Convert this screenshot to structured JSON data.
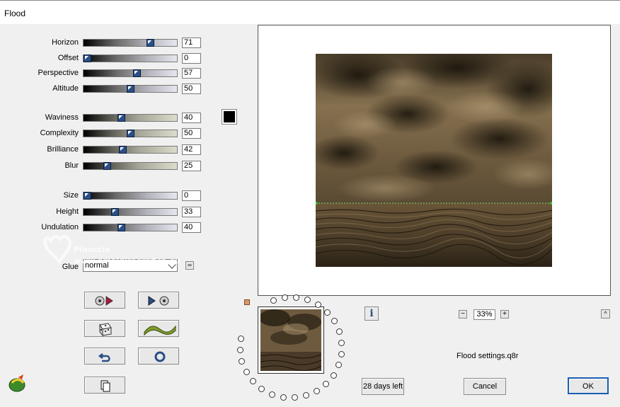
{
  "window": {
    "title": "Flood"
  },
  "params": [
    {
      "key": "horizon",
      "label": "Horizon",
      "value": "71",
      "level": 71,
      "gradient": "gray"
    },
    {
      "key": "offset",
      "label": "Offset",
      "value": "0",
      "level": 0,
      "gradient": "gray"
    },
    {
      "key": "perspective",
      "label": "Perspective",
      "value": "57",
      "level": 57,
      "gradient": "gray"
    },
    {
      "key": "altitude",
      "label": "Altitude",
      "value": "50",
      "level": 50,
      "gradient": "gray"
    },
    {
      "key": "waviness",
      "label": "Waviness",
      "value": "40",
      "level": 40,
      "gradient": "khaki"
    },
    {
      "key": "complexity",
      "label": "Complexity",
      "value": "50",
      "level": 50,
      "gradient": "khaki"
    },
    {
      "key": "brilliance",
      "label": "Brilliance",
      "value": "42",
      "level": 42,
      "gradient": "khaki"
    },
    {
      "key": "blur",
      "label": "Blur",
      "value": "25",
      "level": 25,
      "gradient": "khaki"
    },
    {
      "key": "size",
      "label": "Size",
      "value": "0",
      "level": 0,
      "gradient": "gray"
    },
    {
      "key": "height",
      "label": "Height",
      "value": "33",
      "level": 33,
      "gradient": "gray"
    },
    {
      "key": "undulation",
      "label": "Undulation",
      "value": "40",
      "level": 40,
      "gradient": "gray"
    }
  ],
  "color_swatch": {
    "color": "#000000"
  },
  "glue": {
    "label": "Glue",
    "value": "normal"
  },
  "buttons": {
    "reset_previous_icon": "film-reel-play-red-icon",
    "reset_next_icon": "play-film-reel-icon",
    "random_icon": "dice-icon",
    "wave_icon": "wave-icon",
    "undo_icon": "undo-arrow-icon",
    "reset_icon": "circle-reset-icon",
    "copy_icon": "copy-pages-icon"
  },
  "zoom": {
    "value": "33%",
    "minus": "−",
    "plus": "+"
  },
  "settings_file": "Flood settings.q8r",
  "trial": "28 days left",
  "cancel": "Cancel",
  "ok": "OK",
  "watermark": {
    "line1": "Pinuccia",
    "line2": "www.amaidiregrafica.eu"
  },
  "colors": {
    "sky": "#8a7252",
    "dark_cloud": "#1e1a12",
    "water": "#6e5a3c"
  }
}
